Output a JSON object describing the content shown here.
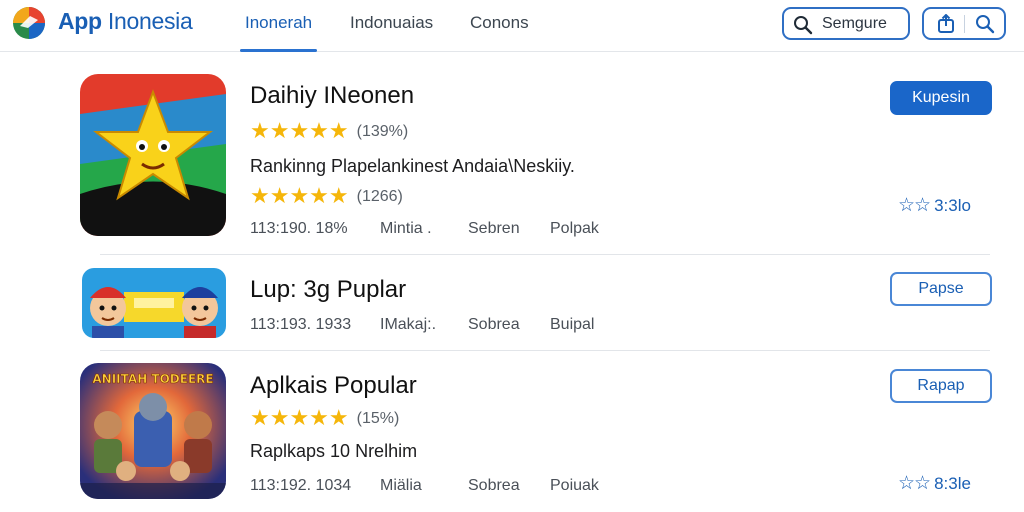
{
  "header": {
    "brand_app": "App",
    "brand_rest": "Inonesia",
    "tabs": [
      {
        "label": "Inonerah",
        "active": true
      },
      {
        "label": "Indonuaias",
        "active": false
      },
      {
        "label": "Conons",
        "active": false
      }
    ],
    "search_label": "Semgure",
    "icons": [
      "share-icon",
      "search-icon"
    ]
  },
  "apps": [
    {
      "title": "Daihiy INeonen",
      "rating_stars": "★★★★★",
      "rating_count": "(139%)",
      "description": "Rankinng Plapelankinest Andaia\\Neskiiy.",
      "rating2_stars": "★★★★★",
      "rating2_count": "(1266)",
      "meta": [
        "113:190. 18%",
        "Mintia .",
        "Sebren",
        "Polpak"
      ],
      "button": "Kupesin",
      "button_style": "primary",
      "side_stars": "☆☆",
      "side_text": "3:3lo"
    },
    {
      "title": "Lup: 3g Puplar",
      "meta": [
        "113:193. 1933",
        "IMakaj:.",
        "Sobrea",
        "Buipal"
      ],
      "button": "Papse",
      "button_style": "outline"
    },
    {
      "title": "Aplkais Popular",
      "rating_stars": "★★★★★",
      "rating_count": "(15%)",
      "description": "Raplkaps 10 Nrelhim",
      "meta": [
        "113:192. 1034",
        "Miälia",
        "Sobrea",
        "Poiuak"
      ],
      "button": "Rapap",
      "button_style": "outline",
      "side_stars": "☆☆",
      "side_text": "8:3le"
    }
  ],
  "thumb3_text": "ANIITAH TODEERE",
  "colors": {
    "accent": "#1a66c9",
    "star": "#f5b60a",
    "divider": "#e2e5e9"
  }
}
